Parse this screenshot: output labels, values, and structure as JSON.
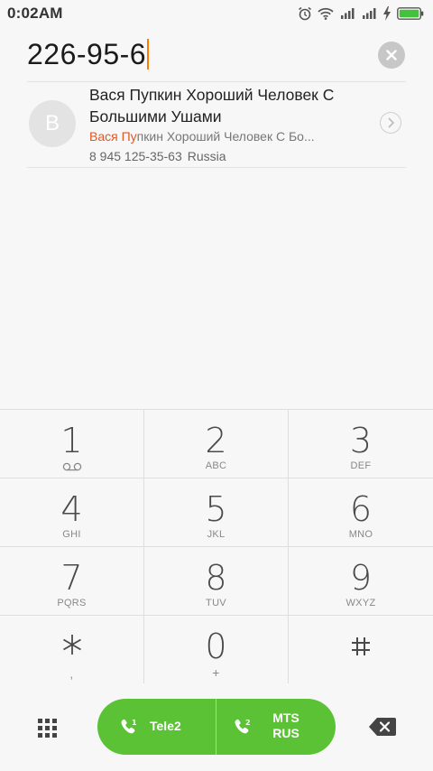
{
  "status_bar": {
    "time": "0:02AM",
    "icons": [
      "alarm-icon",
      "wifi-icon",
      "signal-sim1-icon",
      "signal-sim2-icon",
      "charging-icon",
      "battery-icon"
    ],
    "battery_color": "#45c23b"
  },
  "dialer": {
    "typed_number": "226-95-6",
    "caret_color": "#ff7a00"
  },
  "contact": {
    "avatar_letter": "В",
    "name": "Вася Пупкин Хороший Человек С Большими Ушами",
    "match_highlight": "Вася Пу",
    "match_rest": "пкин Хороший Человек С Бо...",
    "phone": "8 945 125-35-63",
    "region": "Russia",
    "highlight_color": "#e2571e"
  },
  "keypad": {
    "keys": [
      {
        "digit": "1",
        "letters": ""
      },
      {
        "digit": "2",
        "letters": "ABC"
      },
      {
        "digit": "3",
        "letters": "DEF"
      },
      {
        "digit": "4",
        "letters": "GHI"
      },
      {
        "digit": "5",
        "letters": "JKL"
      },
      {
        "digit": "6",
        "letters": "MNO"
      },
      {
        "digit": "7",
        "letters": "PQRS"
      },
      {
        "digit": "8",
        "letters": "TUV"
      },
      {
        "digit": "9",
        "letters": "WXYZ"
      },
      {
        "digit": "*",
        "letters": ","
      },
      {
        "digit": "0",
        "letters": "+"
      },
      {
        "digit": "#",
        "letters": ""
      }
    ]
  },
  "call_buttons": {
    "sim1_label": "Tele2",
    "sim2_label_line1": "MTS",
    "sim2_label_line2": "RUS",
    "color": "#5bc236"
  }
}
